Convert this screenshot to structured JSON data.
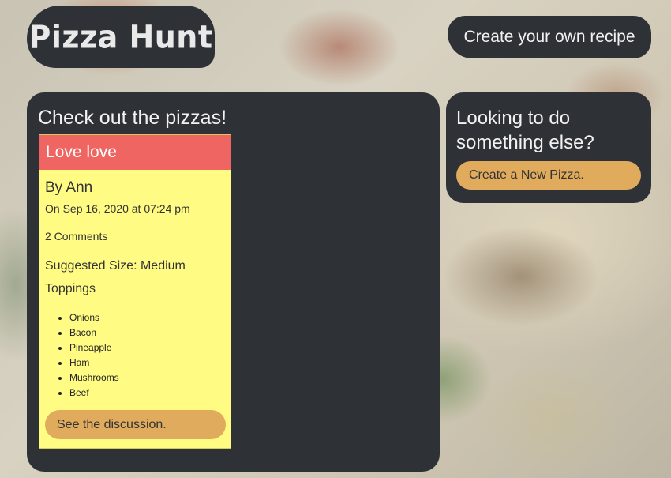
{
  "header": {
    "logo_text": "Pizza Hunt",
    "create_recipe_label": "Create your own recipe"
  },
  "main": {
    "title": "Check out the pizzas!",
    "pizzas": [
      {
        "name": "Love love",
        "author": "By Ann",
        "date": "On Sep 16, 2020 at 07:24 pm",
        "comments": "2 Comments",
        "size": "Suggested Size: Medium",
        "toppings_label": "Toppings",
        "toppings": [
          "Onions",
          "Bacon",
          "Pineapple",
          "Ham",
          "Mushrooms",
          "Beef"
        ],
        "discussion_button": "See the discussion."
      }
    ]
  },
  "sidebar": {
    "title": "Looking to do something else?",
    "new_pizza_button": "Create a New Pizza."
  },
  "colors": {
    "panel_bg": "#2e3236",
    "card_header": "#ef6561",
    "card_bg": "#fffb83",
    "button_accent": "#e0ab5c"
  }
}
